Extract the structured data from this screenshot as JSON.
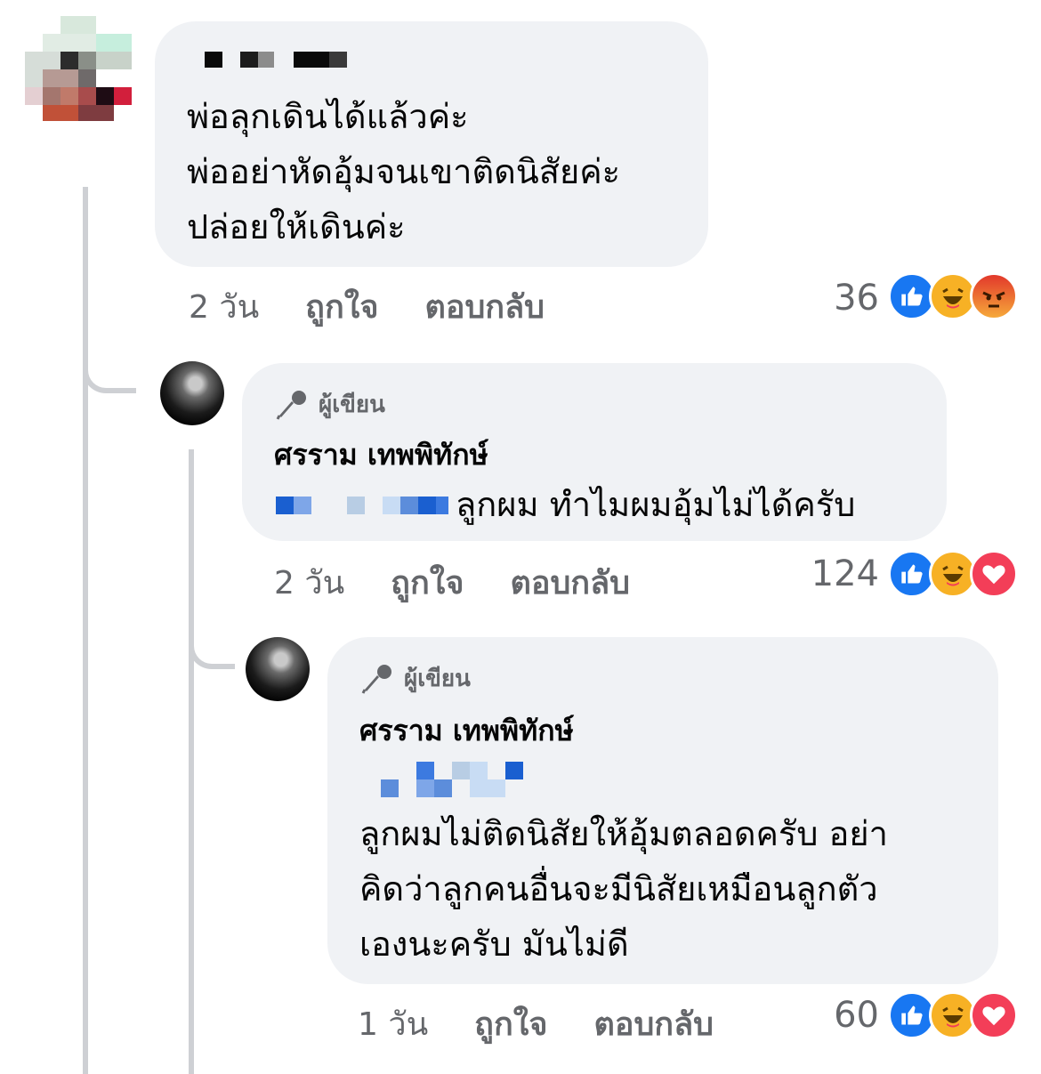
{
  "comments": [
    {
      "text_lines": [
        "พ่อลุกเดินได้แล้วค่ะ",
        "พ่ออย่าหัดอุ้มจนเขาติดนิสัยค่ะ",
        "ปล่อยให้เดินค่ะ"
      ],
      "time": "2 วัน",
      "like_label": "ถูกใจ",
      "reply_label": "ตอบกลับ",
      "reaction_count": "36",
      "reactions": [
        "like",
        "haha",
        "angry"
      ]
    },
    {
      "badge": "ผู้เขียน",
      "author": "ศรราม เทพพิทักษ์",
      "text": "ลูกผม ทำไมผมอุ้มไม่ได้ครับ",
      "time": "2 วัน",
      "like_label": "ถูกใจ",
      "reply_label": "ตอบกลับ",
      "reaction_count": "124",
      "reactions": [
        "like",
        "haha",
        "love"
      ]
    },
    {
      "badge": "ผู้เขียน",
      "author": "ศรราม เทพพิทักษ์",
      "text_lines": [
        "ลูกผมไม่ติดนิสัยให้อุ้มตลอดครับ อย่า",
        "คิดว่าลูกคนอื่นจะมีนิสัยเหมือนลูกตัว",
        "เองนะครับ มันไม่ดี"
      ],
      "time": "1 วัน",
      "like_label": "ถูกใจ",
      "reply_label": "ตอบกลับ",
      "reaction_count": "60",
      "reactions": [
        "like",
        "haha",
        "love"
      ]
    }
  ],
  "colors": {
    "bubble": "#f0f2f5",
    "meta_text": "#65676b",
    "thread_line": "#ced0d4",
    "like": "#1877f2",
    "haha": "#f7b125",
    "love": "#f33e58",
    "angry": "#e9710f"
  }
}
